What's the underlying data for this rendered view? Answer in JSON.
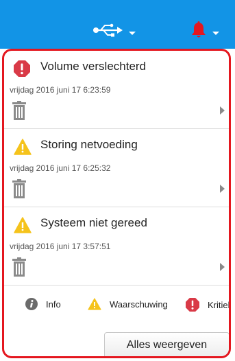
{
  "topbar": {
    "usb_icon": "usb-icon",
    "bell_icon": "bell-icon",
    "bell_color": "#e4171f"
  },
  "alerts": [
    {
      "severity": "critical",
      "title": "Volume verslechterd",
      "time": "vrijdag 2016 juni 17 6:23:59"
    },
    {
      "severity": "warning",
      "title": "Storing netvoeding",
      "time": "vrijdag 2016 juni 17 6:25:32"
    },
    {
      "severity": "warning",
      "title": "Systeem niet gereed",
      "time": "vrijdag 2016 juni 17 3:57:51"
    }
  ],
  "legend": {
    "info": "Info",
    "warning": "Waarschuwing",
    "critical": "Kritiek"
  },
  "actions": {
    "show_all": "Alles weergeven"
  },
  "colors": {
    "header": "#1294e6",
    "highlight_border": "#e4171f",
    "critical": "#d93a47",
    "warning": "#f5c31c",
    "info": "#6b6b6b"
  }
}
